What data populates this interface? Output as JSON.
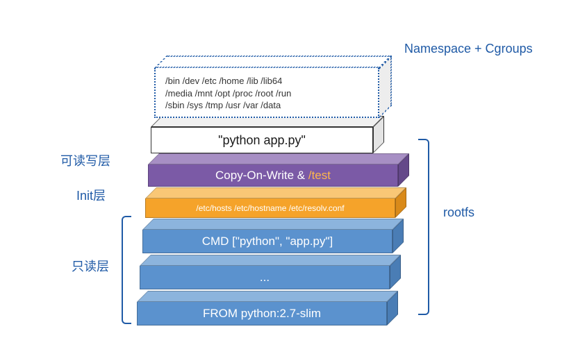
{
  "annotations": {
    "namespace_cgroups": "Namespace + Cgroups",
    "rw_layer": "可读写层",
    "init_layer": "Init层",
    "ro_layer": "只读层",
    "rootfs": "rootfs"
  },
  "namespace_box": {
    "line1": "/bin /dev /etc /home /lib /lib64",
    "line2": "/media /mnt /opt /proc /root /run",
    "line3": "/sbin /sys /tmp /usr /var /data"
  },
  "running_process": {
    "label": "\"python app.py\""
  },
  "cow_layer": {
    "prefix": "Copy-On-Write & ",
    "path": "/test"
  },
  "init_layer_paths": "/etc/hosts /etc/hostname /etc/resolv.conf",
  "readonly_layers": {
    "cmd": "CMD [\"python\", \"app.py\"]",
    "middle": "...",
    "from": "FROM python:2.7-slim"
  },
  "colors": {
    "label_blue": "#1f5aa6",
    "slab_blue": "#5b92ce",
    "slab_orange": "#f5a32a",
    "slab_purple": "#7b5aa6",
    "orange_text": "#ffb74d"
  }
}
